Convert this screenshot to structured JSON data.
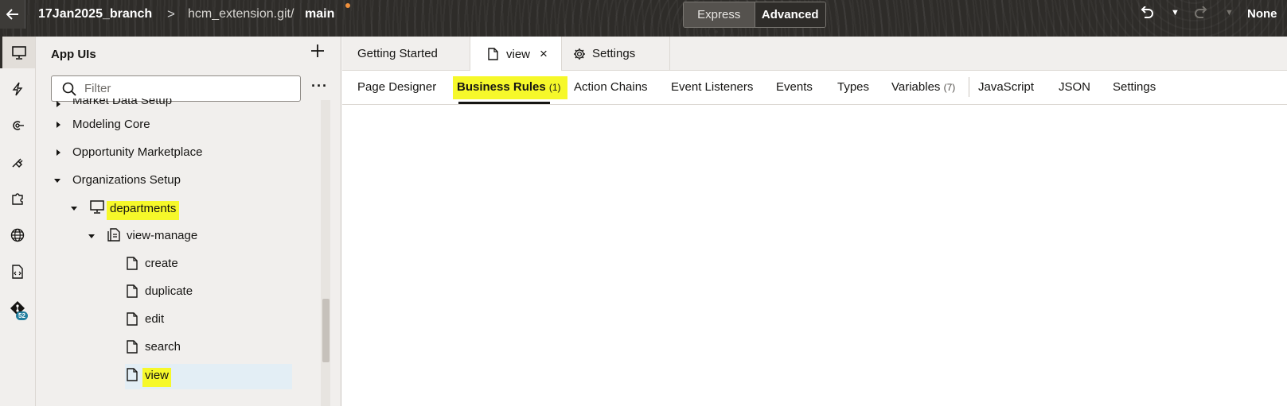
{
  "topbar": {
    "branch_title": "17Jan2025_branch",
    "separator": ">",
    "repo": "hcm_extension.git/",
    "branch": "main",
    "mode_express": "Express",
    "mode_advanced": "Advanced",
    "layout_label": "None"
  },
  "navigator": {
    "title": "App UIs",
    "filter_placeholder": "Filter",
    "tree": [
      {
        "label": "Market Data Setup",
        "state": "closed",
        "level": 0
      },
      {
        "label": "Modeling Core",
        "state": "closed",
        "level": 0
      },
      {
        "label": "Opportunity Marketplace",
        "state": "closed",
        "level": 0
      },
      {
        "label": "Organizations Setup",
        "state": "open",
        "level": 0
      },
      {
        "label": "departments",
        "state": "open",
        "level": 1,
        "highlighted": true
      },
      {
        "label": "view-manage",
        "state": "open",
        "level": 2
      },
      {
        "label": "create",
        "level": 3
      },
      {
        "label": "duplicate",
        "level": 3
      },
      {
        "label": "edit",
        "level": 3
      },
      {
        "label": "search",
        "level": 3
      },
      {
        "label": "view",
        "level": 3,
        "selected": true,
        "highlighted": true
      }
    ]
  },
  "rail": {
    "items": [
      "app-uis-icon",
      "events-icon",
      "services-icon",
      "backends-icon",
      "components-icon",
      "web-apps-icon",
      "source-icon",
      "git-icon"
    ],
    "git_badge": "52"
  },
  "editor_tabs": [
    {
      "label": "Getting Started"
    },
    {
      "label": "view",
      "active": true,
      "closable": true
    },
    {
      "label": "Settings"
    }
  ],
  "sub_tabs": [
    {
      "label": "Page Designer"
    },
    {
      "label": "Business Rules",
      "count": "(1)",
      "active": true
    },
    {
      "label": "Action Chains"
    },
    {
      "label": "Event Listeners"
    },
    {
      "label": "Events"
    },
    {
      "label": "Types"
    },
    {
      "label": "Variables",
      "count": "(7)"
    },
    {
      "label": "JavaScript"
    },
    {
      "label": "JSON"
    },
    {
      "label": "Settings"
    }
  ],
  "colors": {
    "topbar": "#2e2c29",
    "highlight": "#f6f82a",
    "badge": "#227e9e",
    "selected_row": "#e3eef5"
  }
}
